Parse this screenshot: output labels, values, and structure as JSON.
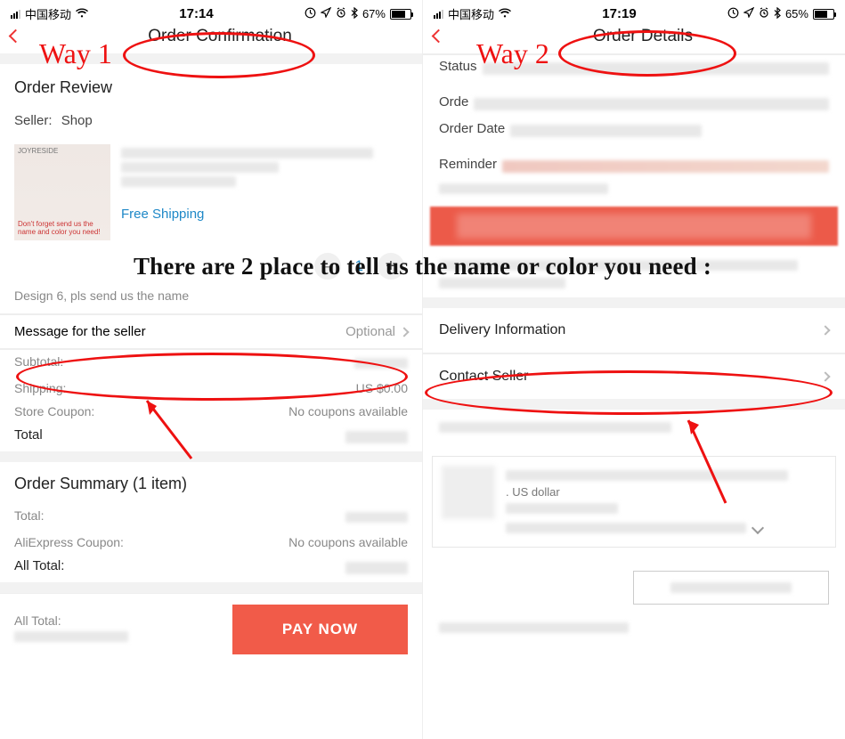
{
  "annotations": {
    "way1": "Way 1",
    "way2": "Way 2",
    "center_text": "There are 2 place to tell us the name or color you need :"
  },
  "left": {
    "status": {
      "carrier": "中国移动",
      "time": "17:14",
      "battery_pct": "67%",
      "battery_fill_pct": 67
    },
    "nav_title": "Order Confirmation",
    "order_review_title": "Order Review",
    "seller_label": "Seller:",
    "seller_value": "Shop",
    "product": {
      "thumb_brand": "JOYRESIDE",
      "thumb_caption": "Don't forget send us the name and color you need!",
      "free_shipping": "Free Shipping",
      "qty": "1",
      "variant": "Design 6, pls send us the name"
    },
    "message_seller": {
      "label": "Message for the seller",
      "placeholder": "Optional"
    },
    "summary": {
      "subtotal_label": "Subtotal:",
      "shipping_label": "Shipping:",
      "shipping_value": "US $0.00",
      "store_coupon_label": "Store Coupon:",
      "no_coupons": "No coupons available",
      "total_label": "Total"
    },
    "order_summary": {
      "title": "Order Summary (1 item)",
      "total_label": "Total:",
      "ali_coupon_label": "AliExpress Coupon:",
      "no_coupons": "No coupons available",
      "all_total_label": "All Total:",
      "footer_all_total_label": "All Total:"
    },
    "pay_now": "PAY NOW"
  },
  "right": {
    "status": {
      "carrier": "中国移动",
      "time": "17:19",
      "battery_pct": "65%",
      "battery_fill_pct": 65
    },
    "nav_title": "Order Details",
    "status_label": "Status",
    "order_label": "Orde",
    "order_date_label": "Order Date",
    "reminder_label": "Reminder",
    "delivery_info": "Delivery Information",
    "contact_seller": "Contact Seller",
    "currency_note": "US dollar"
  }
}
